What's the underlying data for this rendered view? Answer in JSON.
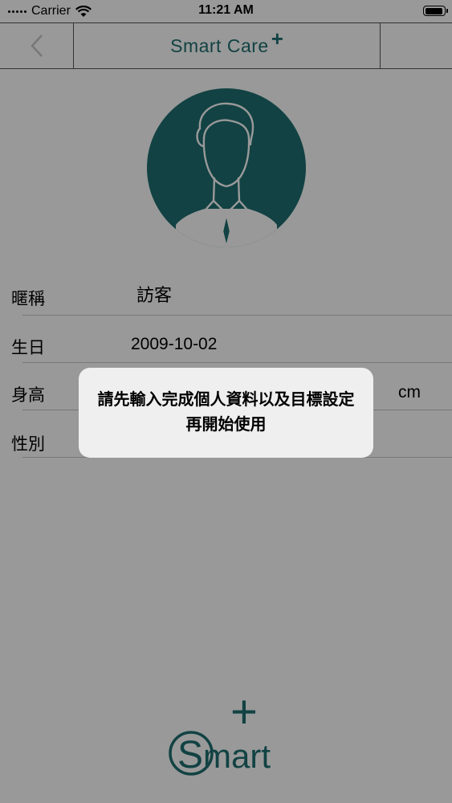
{
  "status_bar": {
    "carrier": "Carrier",
    "time": "11:21 AM",
    "battery_level": 0.95
  },
  "nav": {
    "title": "Smart Care",
    "title_sup": "+"
  },
  "profile": {
    "rows": [
      {
        "label": "暱稱",
        "value": "訪客"
      },
      {
        "label": "生日",
        "value": "2009-10-02"
      },
      {
        "label": "身高",
        "value": "",
        "unit": "cm"
      },
      {
        "label": "性別",
        "value": ""
      }
    ]
  },
  "toast": {
    "message": "請先輸入完成個人資料以及目標設定再開始使用"
  },
  "logo": {
    "text": "mart",
    "letter": "S",
    "plus": "+"
  },
  "colors": {
    "brand": "#1f6e70",
    "overlay": "rgba(0,0,0,0.4)",
    "toast_bg": "#efefef"
  }
}
